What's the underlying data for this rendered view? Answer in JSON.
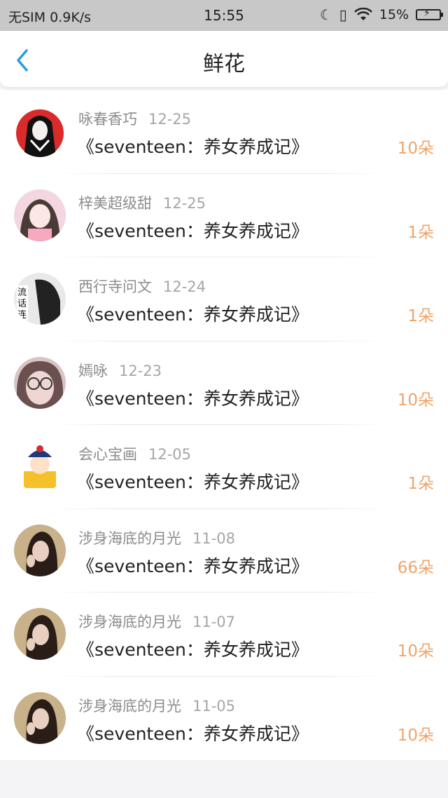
{
  "status_bar": {
    "carrier": "无SIM 0.9K/s",
    "time": "15:55",
    "battery": "15%"
  },
  "header": {
    "title": "鲜花"
  },
  "items": [
    {
      "user": "咏春香巧",
      "date": "12-25",
      "book": "《seventeen：养女养成记》",
      "count": "10朵"
    },
    {
      "user": "梓美超级甜",
      "date": "12-25",
      "book": "《seventeen：养女养成记》",
      "count": "1朵"
    },
    {
      "user": "西行寺问文",
      "date": "12-24",
      "book": "《seventeen：养女养成记》",
      "count": "1朵"
    },
    {
      "user": "嫣咏",
      "date": "12-23",
      "book": "《seventeen：养女养成记》",
      "count": "10朵"
    },
    {
      "user": "会心宝画",
      "date": "12-05",
      "book": "《seventeen：养女养成记》",
      "count": "1朵"
    },
    {
      "user": "涉身海底的月光",
      "date": "11-08",
      "book": "《seventeen：养女养成记》",
      "count": "66朵"
    },
    {
      "user": "涉身海底的月光",
      "date": "11-07",
      "book": "《seventeen：养女养成记》",
      "count": "10朵"
    },
    {
      "user": "涉身海底的月光",
      "date": "11-05",
      "book": "《seventeen：养女养成记》",
      "count": "10朵"
    }
  ],
  "colors": {
    "accent_back": "#2d9cdb",
    "count": "#f0a46a"
  }
}
